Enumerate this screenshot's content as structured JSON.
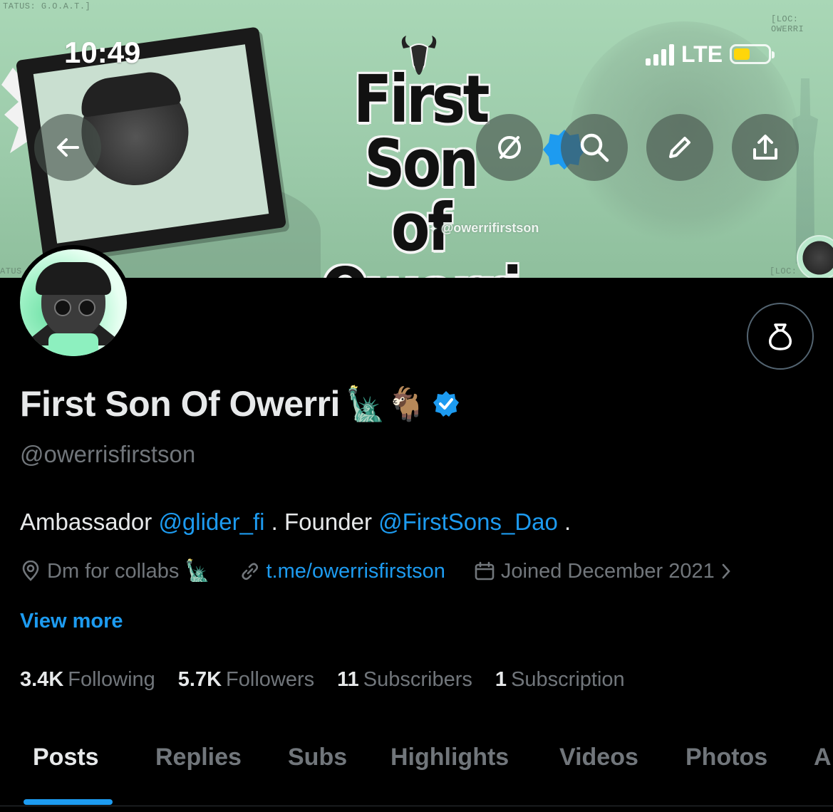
{
  "status_bar": {
    "time": "10:49",
    "network": "LTE",
    "battery_color": "#ffd60a"
  },
  "banner": {
    "logo_line1": "First Son",
    "logo_line2": "of Owerri",
    "logo_handle": "@owerrifirstson",
    "corner_top_left": "TATUS: G.O.A.T.]",
    "corner_top_right": "[LOC: OWERRI",
    "corner_bottom_left": "ATUS",
    "corner_bottom_right": "[LOC: O",
    "background_color": "#a9d7b6"
  },
  "toolbar": {
    "back_icon": "back-arrow-icon",
    "grok_icon": "grok-icon",
    "search_icon": "search-icon",
    "edit_icon": "pencil-icon",
    "share_icon": "share-icon"
  },
  "profile": {
    "display_name": "First Son Of Owerri",
    "name_emojis": "🗽🐐",
    "handle": "@owerrisfirstson",
    "bio_prefix": "Ambassador ",
    "bio_link1": "@glider_fi",
    "bio_middle": " . Founder ",
    "bio_link2": "@FirstSons_Dao",
    "bio_suffix": " .",
    "location": "Dm for collabs 🗽",
    "website": "t.me/owerrisfirstson",
    "joined": "Joined December 2021",
    "view_more": "View more",
    "accent_color": "#1d9bf0"
  },
  "stats": [
    {
      "value": "3.4K",
      "label": "Following"
    },
    {
      "value": "5.7K",
      "label": "Followers"
    },
    {
      "value": "11",
      "label": "Subscribers"
    },
    {
      "value": "1",
      "label": "Subscription"
    }
  ],
  "tabs": [
    {
      "label": "Posts",
      "active": true
    },
    {
      "label": "Replies",
      "active": false
    },
    {
      "label": "Subs",
      "active": false
    },
    {
      "label": "Highlights",
      "active": false
    },
    {
      "label": "Videos",
      "active": false
    },
    {
      "label": "Photos",
      "active": false
    },
    {
      "label": "A",
      "active": false
    }
  ]
}
